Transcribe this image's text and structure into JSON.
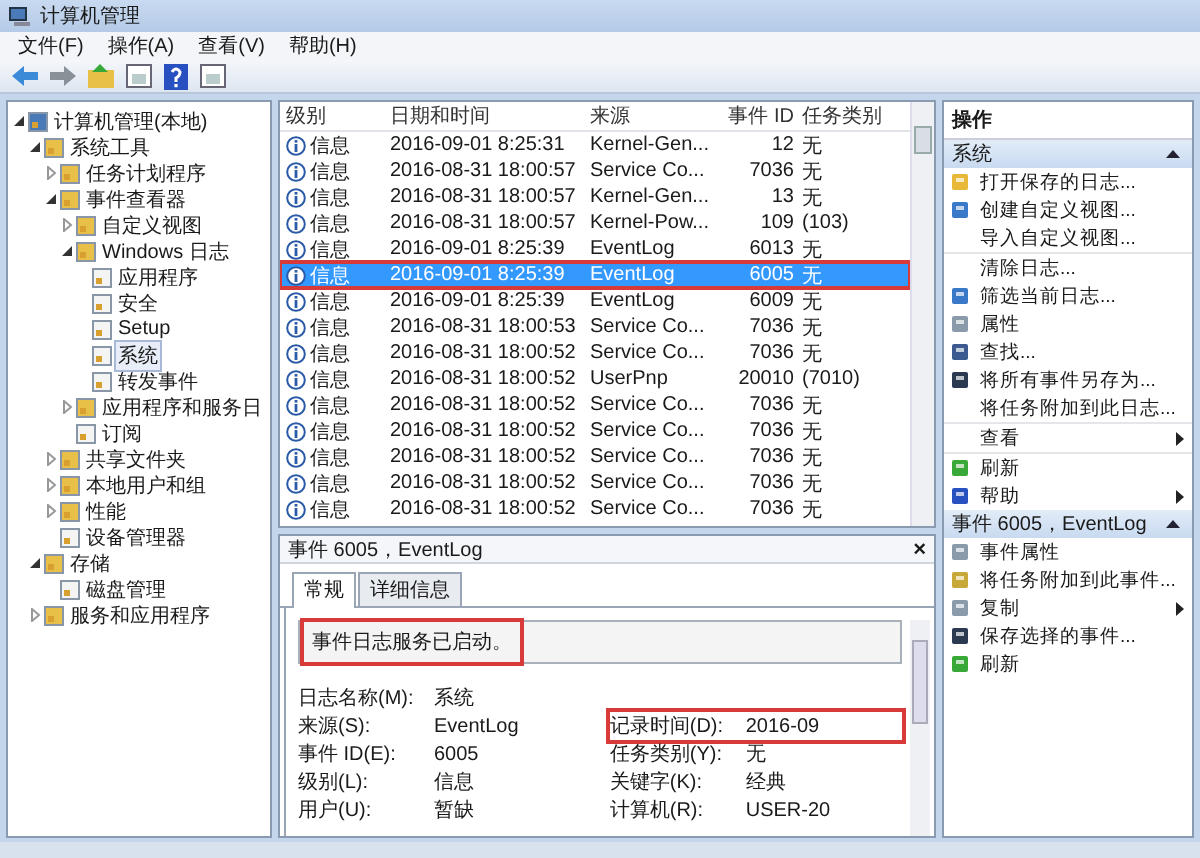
{
  "window": {
    "title": "计算机管理"
  },
  "menu": [
    "文件(F)",
    "操作(A)",
    "查看(V)",
    "帮助(H)"
  ],
  "tree": [
    {
      "label": "计算机管理(本地)",
      "selected": false,
      "expanded": true,
      "children": [
        {
          "label": "系统工具",
          "selected": false,
          "expanded": true,
          "children": [
            {
              "label": "任务计划程序",
              "selected": false,
              "expanded": false
            },
            {
              "label": "事件查看器",
              "selected": false,
              "expanded": true,
              "children": [
                {
                  "label": "自定义视图",
                  "selected": false,
                  "expanded": false
                },
                {
                  "label": "Windows 日志",
                  "selected": false,
                  "expanded": true,
                  "children": [
                    {
                      "label": "应用程序",
                      "selected": false
                    },
                    {
                      "label": "安全",
                      "selected": false
                    },
                    {
                      "label": "Setup",
                      "selected": false
                    },
                    {
                      "label": "系统",
                      "selected": true
                    },
                    {
                      "label": "转发事件",
                      "selected": false
                    }
                  ]
                },
                {
                  "label": "应用程序和服务日",
                  "selected": false,
                  "expanded": false
                },
                {
                  "label": "订阅",
                  "selected": false
                }
              ]
            },
            {
              "label": "共享文件夹",
              "selected": false,
              "expanded": false
            },
            {
              "label": "本地用户和组",
              "selected": false,
              "expanded": false
            },
            {
              "label": "性能",
              "selected": false,
              "expanded": false
            },
            {
              "label": "设备管理器",
              "selected": false
            }
          ]
        },
        {
          "label": "存储",
          "selected": false,
          "expanded": true,
          "children": [
            {
              "label": "磁盘管理",
              "selected": false
            }
          ]
        },
        {
          "label": "服务和应用程序",
          "selected": false,
          "expanded": false
        }
      ]
    }
  ],
  "table": {
    "columns": [
      "级别",
      "日期和时间",
      "来源",
      "事件 ID",
      "任务类别"
    ],
    "rows": [
      {
        "level": "信息",
        "datetime": "2016-09-01 8:25:31",
        "source": "Kernel-Gen...",
        "event_id": "12",
        "task_category": "无",
        "selected": false,
        "annotated": false
      },
      {
        "level": "信息",
        "datetime": "2016-08-31 18:00:57",
        "source": "Service Co...",
        "event_id": "7036",
        "task_category": "无",
        "selected": false,
        "annotated": false
      },
      {
        "level": "信息",
        "datetime": "2016-08-31 18:00:57",
        "source": "Kernel-Gen...",
        "event_id": "13",
        "task_category": "无",
        "selected": false,
        "annotated": false
      },
      {
        "level": "信息",
        "datetime": "2016-08-31 18:00:57",
        "source": "Kernel-Pow...",
        "event_id": "109",
        "task_category": "(103)",
        "selected": false,
        "annotated": false
      },
      {
        "level": "信息",
        "datetime": "2016-09-01 8:25:39",
        "source": "EventLog",
        "event_id": "6013",
        "task_category": "无",
        "selected": false,
        "annotated": false
      },
      {
        "level": "信息",
        "datetime": "2016-09-01 8:25:39",
        "source": "EventLog",
        "event_id": "6005",
        "task_category": "无",
        "selected": true,
        "annotated": true
      },
      {
        "level": "信息",
        "datetime": "2016-09-01 8:25:39",
        "source": "EventLog",
        "event_id": "6009",
        "task_category": "无",
        "selected": false,
        "annotated": false
      },
      {
        "level": "信息",
        "datetime": "2016-08-31 18:00:53",
        "source": "Service Co...",
        "event_id": "7036",
        "task_category": "无",
        "selected": false,
        "annotated": false
      },
      {
        "level": "信息",
        "datetime": "2016-08-31 18:00:52",
        "source": "Service Co...",
        "event_id": "7036",
        "task_category": "无",
        "selected": false,
        "annotated": false
      },
      {
        "level": "信息",
        "datetime": "2016-08-31 18:00:52",
        "source": "UserPnp",
        "event_id": "20010",
        "task_category": "(7010)",
        "selected": false,
        "annotated": false
      },
      {
        "level": "信息",
        "datetime": "2016-08-31 18:00:52",
        "source": "Service Co...",
        "event_id": "7036",
        "task_category": "无",
        "selected": false,
        "annotated": false
      },
      {
        "level": "信息",
        "datetime": "2016-08-31 18:00:52",
        "source": "Service Co...",
        "event_id": "7036",
        "task_category": "无",
        "selected": false,
        "annotated": false
      },
      {
        "level": "信息",
        "datetime": "2016-08-31 18:00:52",
        "source": "Service Co...",
        "event_id": "7036",
        "task_category": "无",
        "selected": false,
        "annotated": false
      },
      {
        "level": "信息",
        "datetime": "2016-08-31 18:00:52",
        "source": "Service Co...",
        "event_id": "7036",
        "task_category": "无",
        "selected": false,
        "annotated": false
      },
      {
        "level": "信息",
        "datetime": "2016-08-31 18:00:52",
        "source": "Service Co...",
        "event_id": "7036",
        "task_category": "无",
        "selected": false,
        "annotated": false
      }
    ]
  },
  "detail": {
    "title": "事件 6005，EventLog",
    "close": "×",
    "tabs": [
      {
        "label": "常规",
        "selected": true
      },
      {
        "label": "详细信息",
        "selected": false
      }
    ],
    "message": {
      "text": "事件日志服务已启动。",
      "annotated": true
    },
    "left_fields": [
      {
        "label": "日志名称(M):",
        "value": "系统"
      },
      {
        "label": "来源(S):",
        "value": "EventLog"
      },
      {
        "label": "事件 ID(E):",
        "value": "6005"
      },
      {
        "label": "级别(L):",
        "value": "信息"
      },
      {
        "label": "用户(U):",
        "value": "暂缺"
      }
    ],
    "right_fields": [
      {
        "label": "记录时间(D):",
        "value": "2016-09",
        "annotated": true
      },
      {
        "label": "任务类别(Y):",
        "value": "无",
        "annotated": false
      },
      {
        "label": "关键字(K):",
        "value": "经典",
        "annotated": false
      },
      {
        "label": "计算机(R):",
        "value": "USER-20",
        "annotated": false
      }
    ]
  },
  "actions": {
    "title": "操作",
    "sections": [
      {
        "title": "系统",
        "items": [
          {
            "label": "打开保存的日志...",
            "submenu": false,
            "separator_after": false
          },
          {
            "label": "创建自定义视图...",
            "submenu": false,
            "separator_after": false
          },
          {
            "label": "导入自定义视图...",
            "submenu": false,
            "separator_after": true
          },
          {
            "label": "清除日志...",
            "submenu": false,
            "separator_after": false
          },
          {
            "label": "筛选当前日志...",
            "submenu": false,
            "separator_after": false
          },
          {
            "label": "属性",
            "submenu": false,
            "separator_after": false
          },
          {
            "label": "查找...",
            "submenu": false,
            "separator_after": false
          },
          {
            "label": "将所有事件另存为...",
            "submenu": false,
            "separator_after": false
          },
          {
            "label": "将任务附加到此日志...",
            "submenu": false,
            "separator_after": true
          },
          {
            "label": "查看",
            "submenu": true,
            "separator_after": true
          },
          {
            "label": "刷新",
            "submenu": false,
            "separator_after": false
          },
          {
            "label": "帮助",
            "submenu": true,
            "separator_after": false
          }
        ]
      },
      {
        "title": "事件 6005，EventLog",
        "items": [
          {
            "label": "事件属性",
            "submenu": false,
            "separator_after": false
          },
          {
            "label": "将任务附加到此事件...",
            "submenu": false,
            "separator_after": false
          },
          {
            "label": "复制",
            "submenu": true,
            "separator_after": false
          },
          {
            "label": "保存选择的事件...",
            "submenu": false,
            "separator_after": false
          },
          {
            "label": "刷新",
            "submenu": false,
            "separator_after": false
          }
        ]
      }
    ]
  }
}
